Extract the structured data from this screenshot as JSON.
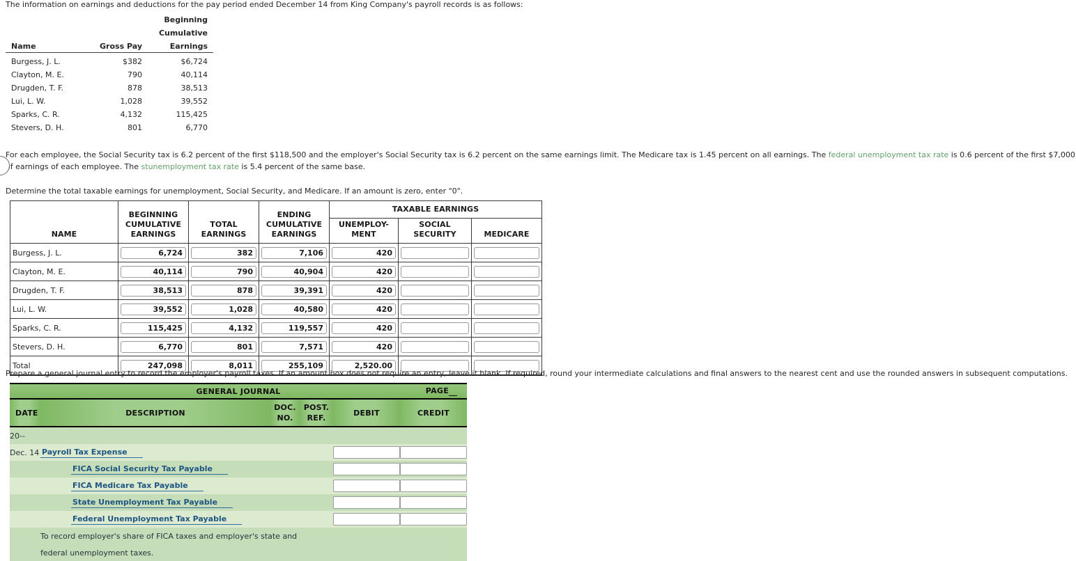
{
  "intro": {
    "text": "The information on earnings and deductions for the pay period ended December 14 from King Company's payroll records is as follows:"
  },
  "summary_table": {
    "headers": {
      "name": "Name",
      "gross_pay": "Gross Pay",
      "beginning": "Beginning",
      "cumulative": "Cumulative",
      "earnings": "Earnings"
    },
    "rows": [
      {
        "name": "Burgess, J. L.",
        "gross_pay": "$382",
        "beginning_cumulative_earnings": "$6,724"
      },
      {
        "name": "Clayton, M. E.",
        "gross_pay": "790",
        "beginning_cumulative_earnings": "40,114"
      },
      {
        "name": "Drugden, T. F.",
        "gross_pay": "878",
        "beginning_cumulative_earnings": "38,513"
      },
      {
        "name": "Lui, L. W.",
        "gross_pay": "1,028",
        "beginning_cumulative_earnings": "39,552"
      },
      {
        "name": "Sparks, C. R.",
        "gross_pay": "4,132",
        "beginning_cumulative_earnings": "115,425"
      },
      {
        "name": "Stevers, D. H.",
        "gross_pay": "801",
        "beginning_cumulative_earnings": "6,770"
      }
    ]
  },
  "rates_paragraph": {
    "part1": "For each employee, the Social Security tax is 6.2 percent of the first $118,500 and the employer's Social Security tax is 6.2 percent on the same earnings limit. The Medicare tax is 1.45 percent on all earnings. The ",
    "link1": "federal unemployment tax rate",
    "part2": " is 0.6 percent of the first $7,000 of earnings of each employee. The ",
    "link2a": "st",
    "link2b": "unemployment tax rate",
    "part3": " is 5.4 percent of the same base."
  },
  "determine_instruction": "Determine the total taxable earnings for unemployment, Social Security, and Medicare. If an amount is zero, enter \"0\".",
  "earnings_table": {
    "headers": {
      "name": "NAME",
      "beginning_cumulative": [
        "BEGINNING",
        "CUMULATIVE",
        "EARNINGS"
      ],
      "total_earnings": [
        "TOTAL",
        "EARNINGS"
      ],
      "ending_cumulative": [
        "ENDING",
        "CUMULATIVE",
        "EARNINGS"
      ],
      "taxable_earnings_group": "TAXABLE EARNINGS",
      "unemployment": [
        "UNEMPLOY-",
        "MENT"
      ],
      "social_security": [
        "SOCIAL",
        "SECURITY"
      ],
      "medicare": "MEDICARE"
    },
    "rows": [
      {
        "name": "Burgess, J. L.",
        "beginning": "6,724",
        "total": "382",
        "ending": "7,106",
        "unemployment": "420",
        "social_security": "",
        "medicare": ""
      },
      {
        "name": "Clayton, M. E.",
        "beginning": "40,114",
        "total": "790",
        "ending": "40,904",
        "unemployment": "420",
        "social_security": "",
        "medicare": ""
      },
      {
        "name": "Drugden, T. F.",
        "beginning": "38,513",
        "total": "878",
        "ending": "39,391",
        "unemployment": "420",
        "social_security": "",
        "medicare": ""
      },
      {
        "name": "Lui, L. W.",
        "beginning": "39,552",
        "total": "1,028",
        "ending": "40,580",
        "unemployment": "420",
        "social_security": "",
        "medicare": ""
      },
      {
        "name": "Sparks, C. R.",
        "beginning": "115,425",
        "total": "4,132",
        "ending": "119,557",
        "unemployment": "420",
        "social_security": "",
        "medicare": ""
      },
      {
        "name": "Stevers, D. H.",
        "beginning": "6,770",
        "total": "801",
        "ending": "7,571",
        "unemployment": "420",
        "social_security": "",
        "medicare": ""
      },
      {
        "name": "Total",
        "beginning": "247,098",
        "total": "8,011",
        "ending": "255,109",
        "unemployment": "2,520.00",
        "social_security": "",
        "medicare": ""
      }
    ]
  },
  "prepare_instruction": "Prepare a general journal entry to record the employer's payroll taxes. If an amount box does not require an entry, leave it blank. If required, round your intermediate calculations and final answers to the nearest cent and use the rounded answers in subsequent computations.",
  "journal": {
    "title": "GENERAL JOURNAL",
    "page_label": "PAGE",
    "page_value": "",
    "headers": {
      "date": "DATE",
      "description": "DESCRIPTION",
      "doc_line1": "DOC.",
      "doc_line2": "NO.",
      "post_line1": "POST.",
      "post_line2": "REF.",
      "debit": "DEBIT",
      "credit": "CREDIT"
    },
    "year_row": "20--",
    "entries": [
      {
        "date": "Dec. 14",
        "account": "Payroll Tax Expense",
        "indent": false,
        "debit": "",
        "credit": ""
      },
      {
        "date": "",
        "account": "FICA Social Security Tax Payable",
        "indent": true,
        "debit": "",
        "credit": ""
      },
      {
        "date": "",
        "account": "FICA Medicare Tax Payable",
        "indent": true,
        "debit": "",
        "credit": ""
      },
      {
        "date": "",
        "account": "State Unemployment Tax Payable",
        "indent": true,
        "debit": "",
        "credit": ""
      },
      {
        "date": "",
        "account": "Federal Unemployment Tax Payable",
        "indent": true,
        "debit": "",
        "credit": ""
      }
    ],
    "memo_line1": "To record employer's share of FICA taxes and employer's state and",
    "memo_line2": "federal unemployment taxes."
  },
  "colors": {
    "journal_header_green": "#8cc06f",
    "journal_subheader_green": "#9fcd8b",
    "row_shade_dark": "#c5ddb9",
    "row_shade_light": "#dcead0",
    "account_link_blue": "#1f5582",
    "glossary_link_green": "#62a06a"
  }
}
